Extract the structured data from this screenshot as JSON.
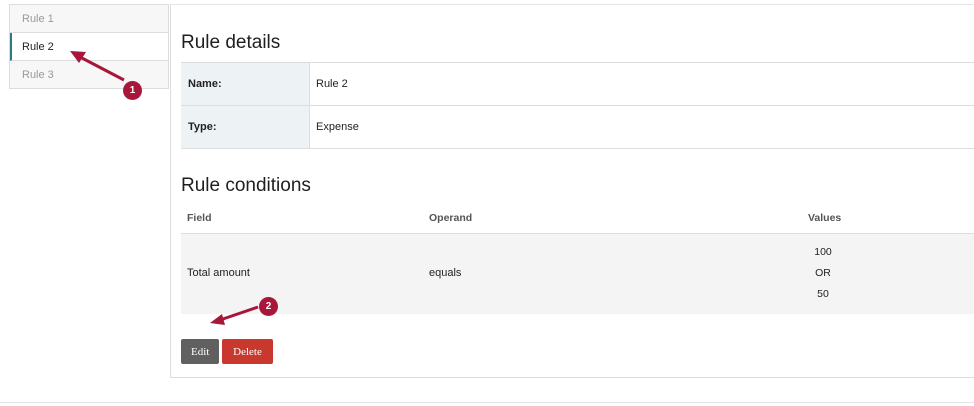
{
  "sidebar": {
    "items": [
      {
        "label": "Rule 1"
      },
      {
        "label": "Rule 2"
      },
      {
        "label": "Rule 3"
      }
    ]
  },
  "details": {
    "title": "Rule details",
    "rows": [
      {
        "key": "Name:",
        "value": "Rule 2"
      },
      {
        "key": "Type:",
        "value": "Expense"
      }
    ]
  },
  "conditions": {
    "title": "Rule conditions",
    "headers": {
      "field": "Field",
      "operand": "Operand",
      "values": "Values"
    },
    "rows": [
      {
        "field": "Total amount",
        "operand": "equals",
        "values": [
          "100",
          "OR",
          "50"
        ]
      }
    ]
  },
  "actions": {
    "edit_label": "Edit",
    "delete_label": "Delete"
  },
  "annotations": {
    "marker1": "1",
    "marker2": "2"
  },
  "colors": {
    "marker": "#a8173a",
    "delete": "#c9382c",
    "edit": "#606060",
    "active_border": "#2c7a86"
  }
}
